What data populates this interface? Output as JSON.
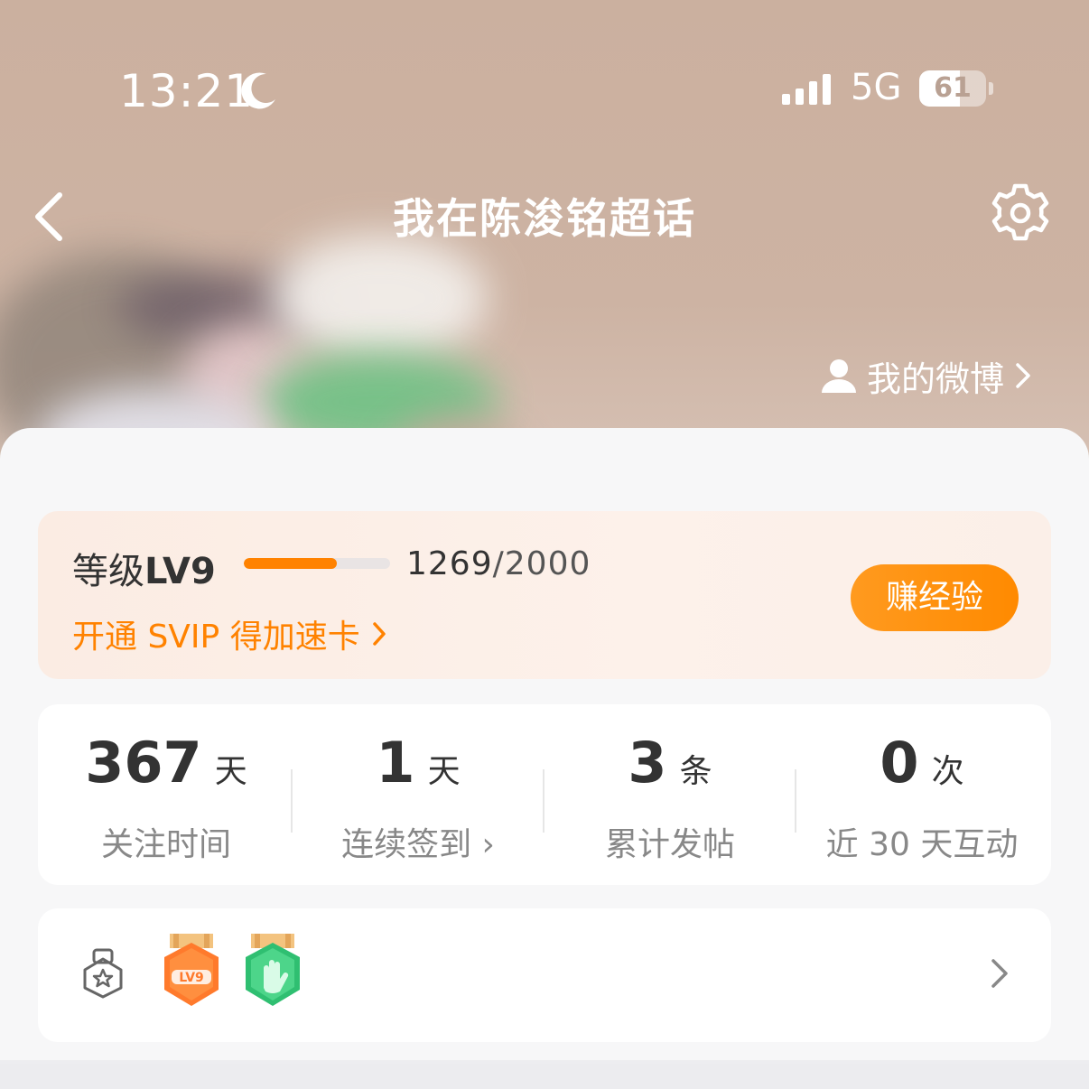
{
  "status_bar": {
    "time": "13:21",
    "network": "5G",
    "battery": "61",
    "battery_level": 0.61
  },
  "nav": {
    "title": "我在陈浚铭超话"
  },
  "my_weibo_label": "我的微博",
  "level": {
    "prefix": "等级",
    "level": "LV9",
    "exp_current": "1269",
    "exp_total": "/2000",
    "progress": 0.6345,
    "svip_link": "开通 SVIP 得加速卡",
    "earn_button": "赚经验"
  },
  "stats": [
    {
      "value": "367",
      "unit": "天",
      "label": "关注时间"
    },
    {
      "value": "1",
      "unit": "天",
      "label": "连续签到 ›"
    },
    {
      "value": "3",
      "unit": "条",
      "label": "累计发帖"
    },
    {
      "value": "0",
      "unit": "次",
      "label": "近 30 天互动"
    }
  ],
  "badges": {
    "lv_badge_text": "LV9"
  },
  "colors": {
    "accent": "#ff8200",
    "header_bg": "#cbb09f"
  }
}
